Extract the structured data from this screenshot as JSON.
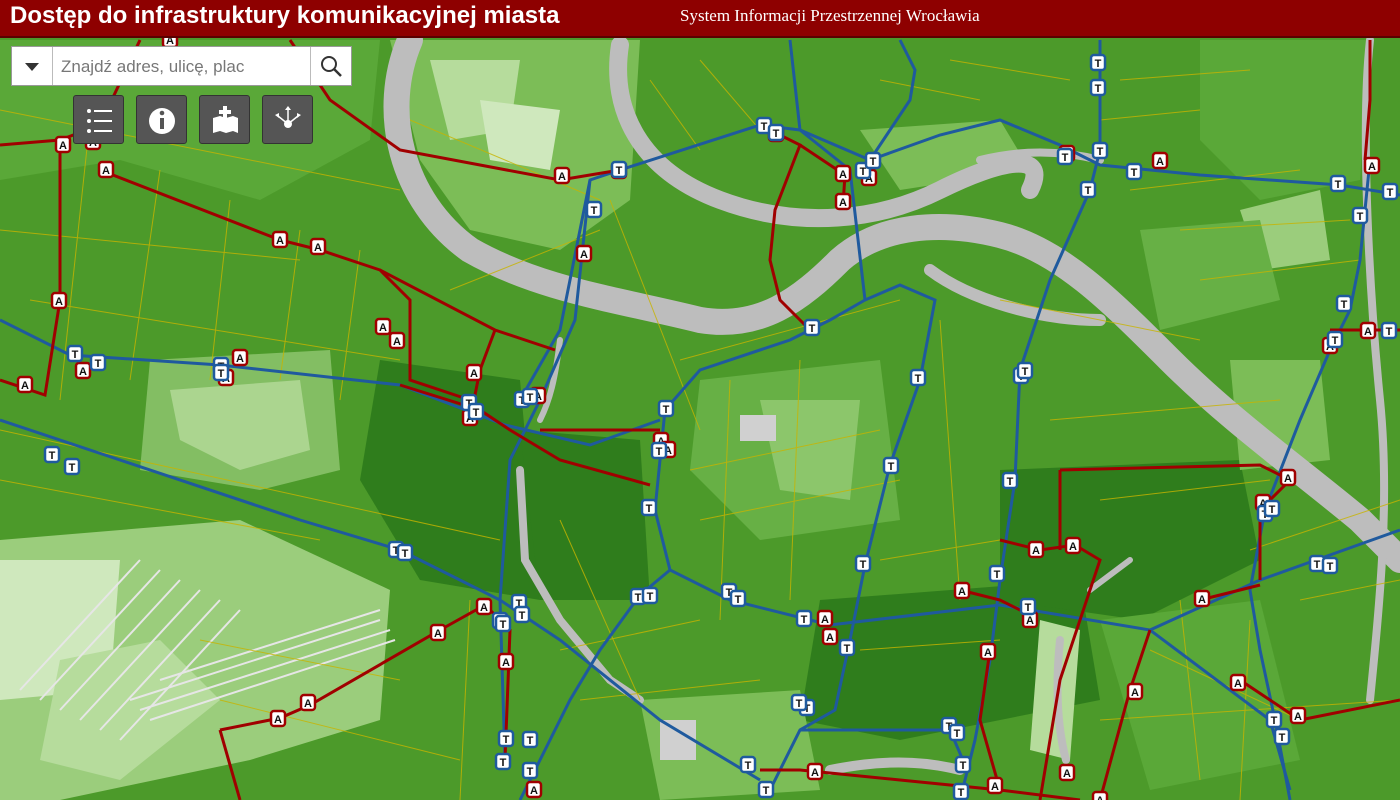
{
  "header": {
    "title": "Dostęp do infrastruktury komunikacyjnej miasta",
    "subtitle": "System Informacji Przestrzennej Wrocławia"
  },
  "search": {
    "placeholder": "Znajdź adres, ulicę, plac",
    "value": ""
  },
  "toolbar": {
    "items": [
      {
        "icon": "list-icon"
      },
      {
        "icon": "info-icon"
      },
      {
        "icon": "add-layer-icon"
      },
      {
        "icon": "share-icon"
      }
    ]
  },
  "map": {
    "stop_labels": {
      "bus": "A",
      "tram": "T"
    },
    "colors": {
      "bus_route": "#a00000",
      "tram_route": "#1f5a9e",
      "river": "#bdbdbd",
      "access_high": "#2f7d1c",
      "access_mid": "#4c9a2a",
      "access_low": "#a8d38a",
      "street": "#c8b400"
    }
  }
}
